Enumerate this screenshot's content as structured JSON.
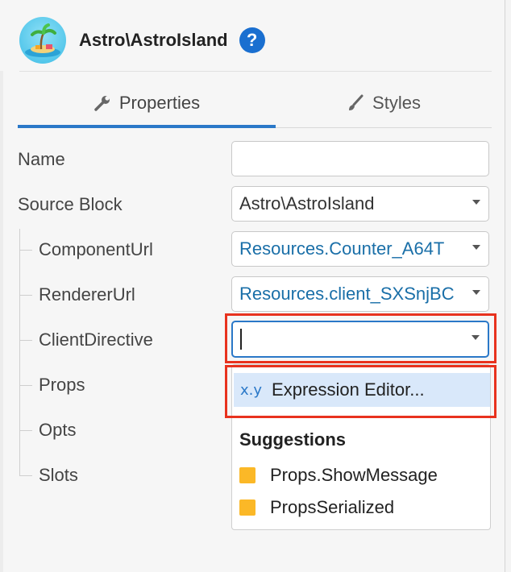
{
  "header": {
    "title": "Astro\\AstroIsland",
    "help_label": "?",
    "avatar_icon": "island-icon"
  },
  "tabs": [
    {
      "label": "Properties",
      "icon": "wrench-icon",
      "active": true
    },
    {
      "label": "Styles",
      "icon": "brush-icon",
      "active": false
    }
  ],
  "fields": {
    "name": {
      "label": "Name",
      "value": ""
    },
    "source_block": {
      "label": "Source Block",
      "value": "Astro\\AstroIsland"
    },
    "component_url": {
      "label": "ComponentUrl",
      "value_prefix": "Resources.",
      "value_suffix": "Counter_A64T"
    },
    "renderer_url": {
      "label": "RendererUrl",
      "value_prefix": "Resources.",
      "value_suffix": "client_SXSnjBC"
    },
    "client_directive": {
      "label": "ClientDirective",
      "value": ""
    },
    "props": {
      "label": "Props"
    },
    "opts": {
      "label": "Opts"
    },
    "slots": {
      "label": "Slots"
    }
  },
  "dropdown": {
    "expression_icon": "x.y",
    "expression_label": "Expression Editor...",
    "suggestions_title": "Suggestions",
    "suggestions": [
      {
        "label": "Props.ShowMessage",
        "color": "#fbb827"
      },
      {
        "label": "PropsSerialized",
        "color": "#fbb827"
      }
    ]
  },
  "colors": {
    "accent": "#2a78c8",
    "highlight": "#e8321e",
    "link_blue": "#1a6fa8"
  }
}
